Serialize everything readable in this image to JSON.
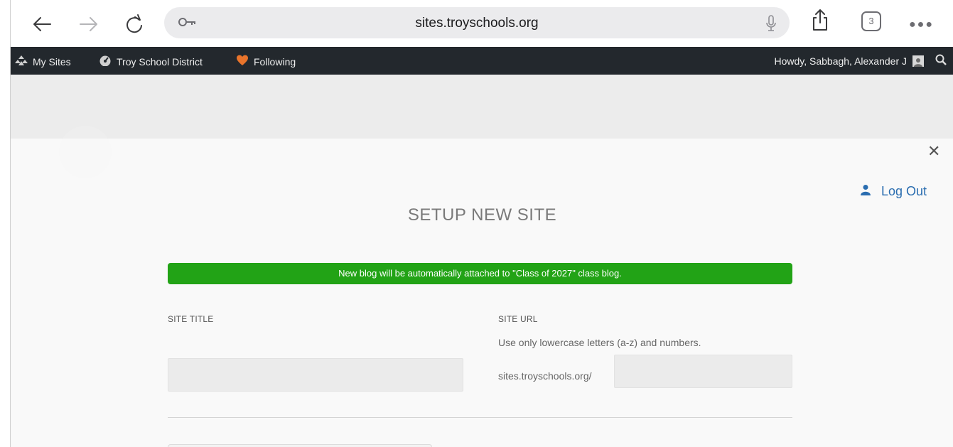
{
  "browser": {
    "url": "sites.troyschools.org",
    "tab_count": "3",
    "icons": [
      "back-arrow-icon",
      "forward-arrow-icon",
      "reload-icon",
      "key-icon",
      "microphone-icon",
      "share-icon",
      "tabs-icon",
      "more-icon"
    ]
  },
  "admin_bar": {
    "my_sites": "My Sites",
    "site_name": "Troy School District",
    "following": "Following",
    "greeting": "Howdy, Sabbagh, Alexander J"
  },
  "modal": {
    "logout_label": "Log Out",
    "title": "SETUP NEW SITE",
    "notice": "New blog will be automatically attached to \"Class of 2027\" class blog.",
    "site_title_label": "SITE TITLE",
    "site_title_value": "",
    "site_url_label": "SITE URL",
    "site_url_hint": "Use only lowercase letters (a-z) and numbers.",
    "url_prefix": "sites.troyschools.org/",
    "site_url_value": ""
  },
  "colors": {
    "admin_bar_bg": "#23282d",
    "notice_bg": "#22a316",
    "link_blue": "#2a6db0"
  }
}
